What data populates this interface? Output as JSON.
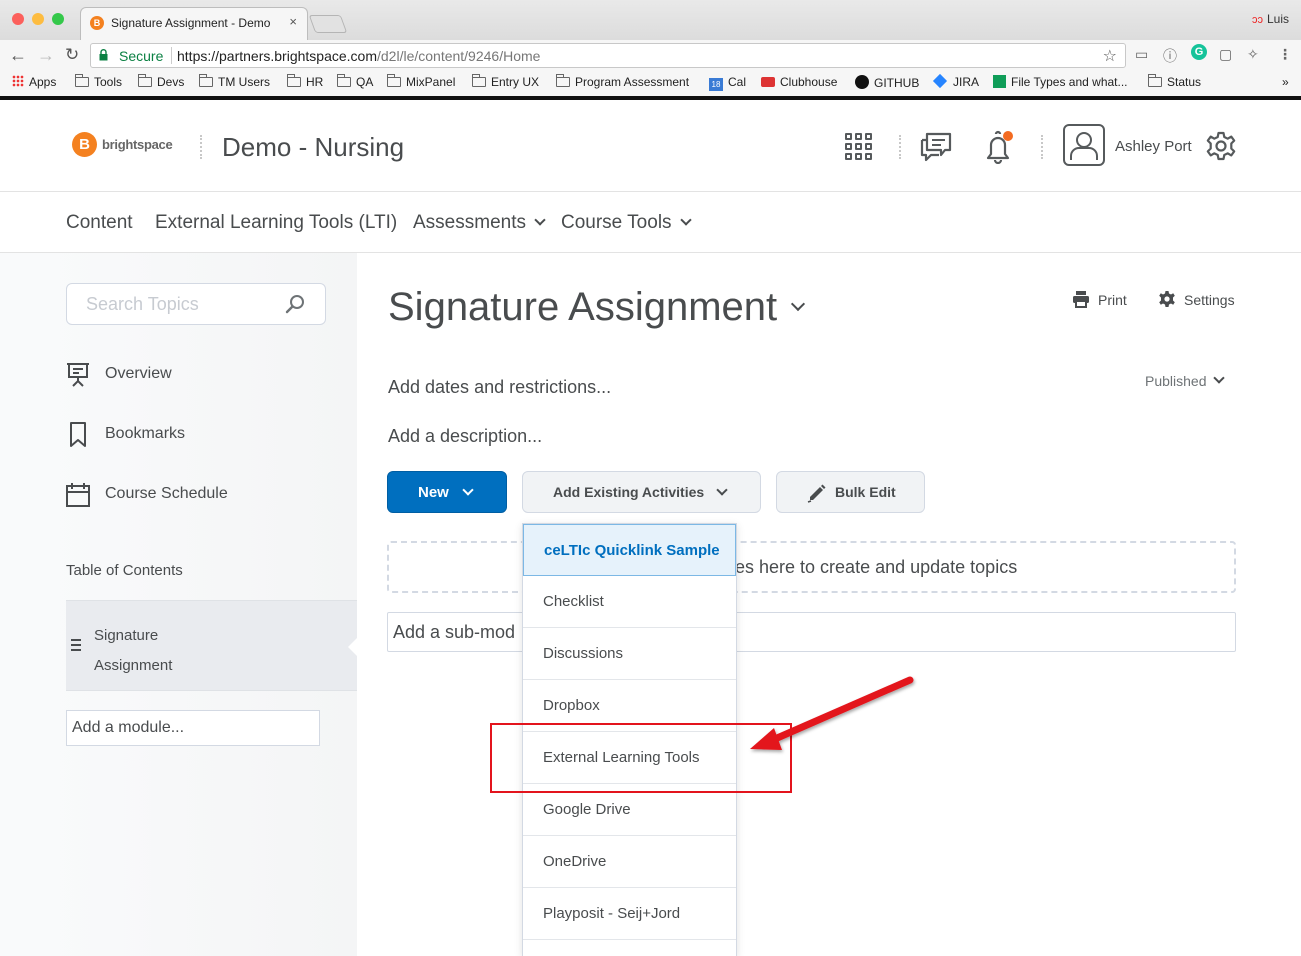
{
  "browser": {
    "tab_title": "Signature Assignment - Demo",
    "tab_close": "×",
    "profile_name": "Luis",
    "secure_label": "Secure",
    "url_host": "https://partners.brightspace.com",
    "url_path": "/d2l/le/content/9246/Home",
    "bookmarks": [
      "Apps",
      "Tools",
      "Devs",
      "TM Users",
      "HR",
      "QA",
      "MixPanel",
      "Entry UX",
      "Program Assessment",
      "Cal",
      "Clubhouse",
      "GITHUB",
      "JIRA",
      "File Types and what...",
      "Status"
    ],
    "bookmarks_overflow": "»",
    "cal_badge": "18"
  },
  "header": {
    "logo_text": "brightspace",
    "course_title": "Demo - Nursing",
    "user_name": "Ashley Port",
    "notification_color": "#f36b21"
  },
  "nav": {
    "items": [
      "Content",
      "External Learning Tools (LTI)",
      "Assessments",
      "Course Tools"
    ]
  },
  "sidebar": {
    "search_placeholder": "Search Topics",
    "items": [
      "Overview",
      "Bookmarks",
      "Course Schedule"
    ],
    "toc_label": "Table of Contents",
    "toc_item_line1": "Signature",
    "toc_item_line2": "Assignment",
    "add_module": "Add a module..."
  },
  "main": {
    "title": "Signature Assignment",
    "print": "Print",
    "settings": "Settings",
    "add_dates": "Add dates and restrictions...",
    "add_description": "Add a description...",
    "status": "Published",
    "new_button": "New",
    "add_existing_button": "Add Existing Activities",
    "bulk_edit_button": "Bulk Edit",
    "dropzone_text": "es here to create and update topics",
    "submodule_text": "Add a sub-mod"
  },
  "menu": {
    "items": [
      "ceLTIc Quicklink Sample",
      "Checklist",
      "Discussions",
      "Dropbox",
      "External Learning Tools",
      "Google Drive",
      "OneDrive",
      "Playposit - Seij+Jord"
    ]
  },
  "colors": {
    "accent": "#006fbf",
    "brand": "#f48120",
    "annotation": "#e3141d"
  }
}
